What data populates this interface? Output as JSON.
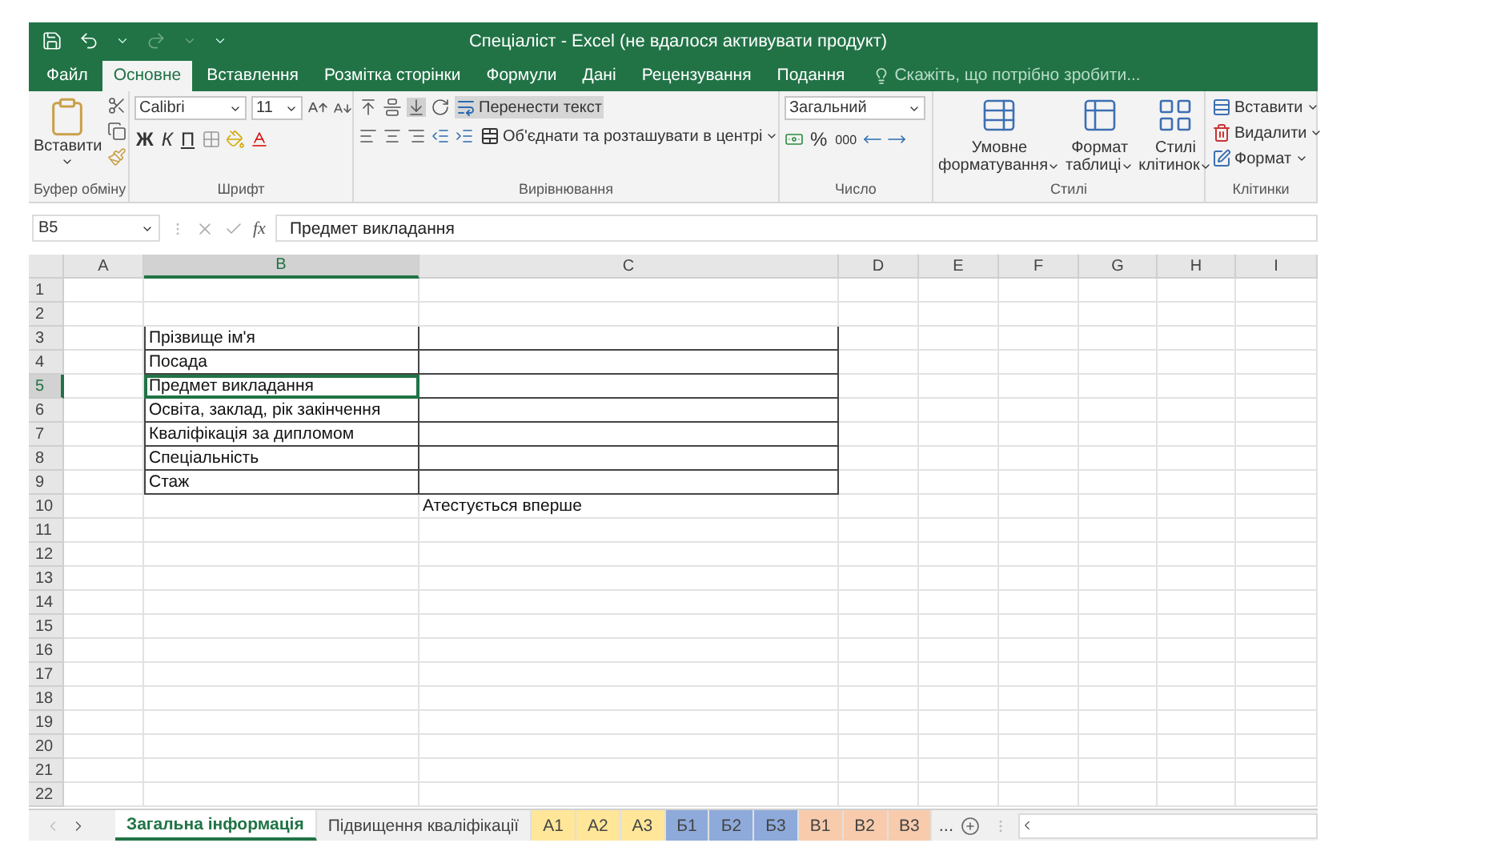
{
  "window": {
    "title": "Спеціаліст - Excel (не вдалося активувати продукт)"
  },
  "ribbon_tabs": [
    {
      "label": "Файл",
      "selected": false
    },
    {
      "label": "Основне",
      "selected": true
    },
    {
      "label": "Вставлення",
      "selected": false
    },
    {
      "label": "Розмітка сторінки",
      "selected": false
    },
    {
      "label": "Формули",
      "selected": false
    },
    {
      "label": "Дані",
      "selected": false
    },
    {
      "label": "Рецензування",
      "selected": false
    },
    {
      "label": "Подання",
      "selected": false
    }
  ],
  "tell_me": {
    "placeholder": "Скажіть, що потрібно зробити..."
  },
  "ribbon": {
    "clipboard": {
      "paste": "Вставити",
      "label": "Буфер обміну"
    },
    "font": {
      "name": "Calibri",
      "size": "11",
      "format_buttons": [
        "Ж",
        "К",
        "П"
      ],
      "label": "Шрифт"
    },
    "alignment": {
      "wrap": "Перенести текст",
      "merge": "Об'єднати та розташувати в центрі",
      "label": "Вирівнювання"
    },
    "number": {
      "format": "Загальний",
      "percent": "%",
      "thousands": "000",
      "label": "Число"
    },
    "styles": {
      "buttons": [
        [
          "Умовне",
          "форматування"
        ],
        [
          "Формат",
          "таблиці"
        ],
        [
          "Стилі",
          "клітинок"
        ]
      ],
      "label": "Стилі"
    },
    "cells": {
      "buttons": [
        "Вставити",
        "Видалити",
        "Формат"
      ],
      "label": "Клітинки"
    }
  },
  "formula_bar": {
    "name_box": "B5",
    "fx": "fx",
    "value": "Предмет викладання"
  },
  "columns": [
    {
      "label": "A",
      "selected": false
    },
    {
      "label": "B",
      "selected": true
    },
    {
      "label": "C",
      "selected": false
    },
    {
      "label": "D",
      "selected": false
    },
    {
      "label": "E",
      "selected": false
    },
    {
      "label": "F",
      "selected": false
    },
    {
      "label": "G",
      "selected": false
    },
    {
      "label": "H",
      "selected": false
    },
    {
      "label": "I",
      "selected": false
    }
  ],
  "rows": [
    {
      "number": "1",
      "selected": false,
      "bordered": false
    },
    {
      "number": "2",
      "selected": false,
      "bordered": false
    },
    {
      "number": "3",
      "selected": false,
      "bordered": true,
      "b": "Прізвище ім'я"
    },
    {
      "number": "4",
      "selected": false,
      "bordered": true,
      "b": "Посада"
    },
    {
      "number": "5",
      "selected": true,
      "bordered": true,
      "b": "Предмет викладання"
    },
    {
      "number": "6",
      "selected": false,
      "bordered": true,
      "b": "Освіта, заклад, рік закінчення"
    },
    {
      "number": "7",
      "selected": false,
      "bordered": true,
      "b": "Кваліфікація за дипломом"
    },
    {
      "number": "8",
      "selected": false,
      "bordered": true,
      "b": "Спеціальність"
    },
    {
      "number": "9",
      "selected": false,
      "bordered": true,
      "b": "Стаж"
    },
    {
      "number": "10",
      "selected": false,
      "bordered": false,
      "c": "Атестується вперше"
    },
    {
      "number": "11",
      "selected": false,
      "bordered": false
    },
    {
      "number": "12",
      "selected": false,
      "bordered": false
    },
    {
      "number": "13",
      "selected": false,
      "bordered": false
    },
    {
      "number": "14",
      "selected": false,
      "bordered": false
    },
    {
      "number": "15",
      "selected": false,
      "bordered": false
    },
    {
      "number": "16",
      "selected": false,
      "bordered": false
    },
    {
      "number": "17",
      "selected": false,
      "bordered": false
    },
    {
      "number": "18",
      "selected": false,
      "bordered": false
    },
    {
      "number": "19",
      "selected": false,
      "bordered": false
    },
    {
      "number": "20",
      "selected": false,
      "bordered": false
    },
    {
      "number": "21",
      "selected": false,
      "bordered": false
    },
    {
      "number": "22",
      "selected": false,
      "bordered": false
    }
  ],
  "sheet_tabs": [
    {
      "label": "Загальна інформація",
      "selected": true
    },
    {
      "label": "Підвищення кваліфікації",
      "selected": false
    },
    {
      "label": "А1",
      "selected": false,
      "color": "#ffe699"
    },
    {
      "label": "А2",
      "selected": false,
      "color": "#ffe699"
    },
    {
      "label": "А3",
      "selected": false,
      "color": "#ffe699"
    },
    {
      "label": "Б1",
      "selected": false,
      "color": "#8eaadb"
    },
    {
      "label": "Б2",
      "selected": false,
      "color": "#8eaadb"
    },
    {
      "label": "Б3",
      "selected": false,
      "color": "#8eaadb"
    },
    {
      "label": "В1",
      "selected": false,
      "color": "#f8cbad"
    },
    {
      "label": "В2",
      "selected": false,
      "color": "#f8cbad"
    },
    {
      "label": "В3",
      "selected": false,
      "color": "#f8cbad"
    }
  ],
  "more_sheets": "..."
}
